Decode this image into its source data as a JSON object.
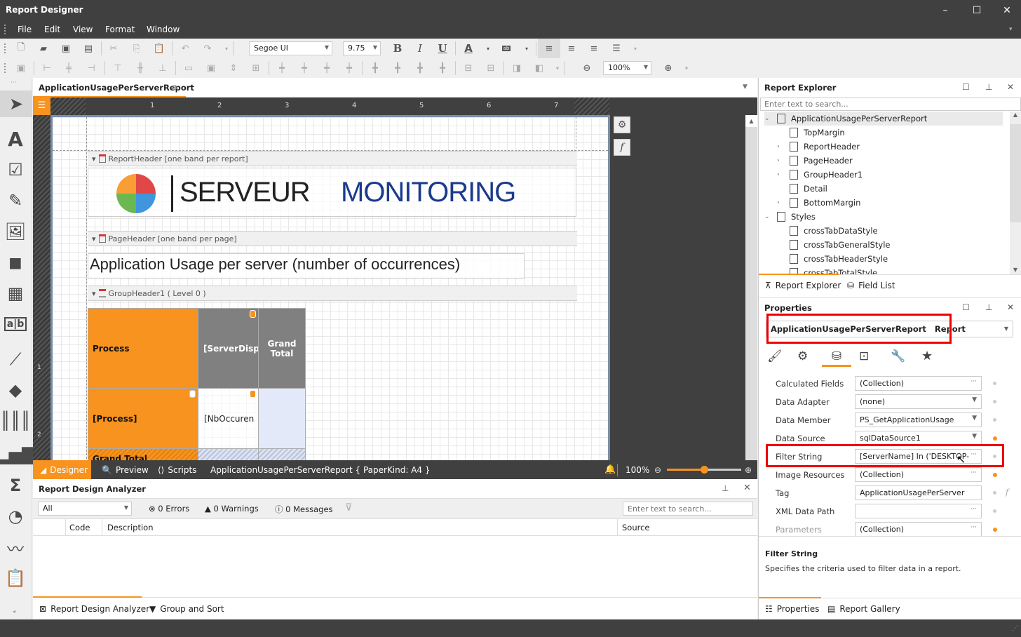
{
  "window": {
    "title": "Report Designer",
    "minimize": "–",
    "maximize": "☐",
    "close": "✕"
  },
  "menu": [
    "File",
    "Edit",
    "View",
    "Format",
    "Window"
  ],
  "toolbar": {
    "font_name": "Segoe UI",
    "font_size": "9.75",
    "bold": "B",
    "italic": "I",
    "underline": "U",
    "font_color": "A",
    "zoom": "100%"
  },
  "document_tab": {
    "label": "ApplicationUsagePerServerReport"
  },
  "ruler": {
    "marks": [
      "1",
      "2",
      "3",
      "4",
      "5",
      "6",
      "7"
    ],
    "vertical_marks": [
      "1",
      "2"
    ]
  },
  "report": {
    "bands": {
      "report_header": "ReportHeader [one band per report]",
      "page_header": "PageHeader [one band per page]",
      "group_header": "GroupHeader1 ( Level 0 )"
    },
    "logo": {
      "part1": "SERVEUR",
      "part2": "MONITORING"
    },
    "page_title": "Application Usage per server (number of occurrences)",
    "crosstab": {
      "process_header": "Process",
      "column_field": "[ServerDisp",
      "grand_total_col": "Grand Total",
      "row_field": "[Process]",
      "data_field": "[NbOccuren",
      "grand_total_row": "Grand Total"
    }
  },
  "bottom_tabs": {
    "designer": "Designer",
    "preview": "Preview",
    "scripts": "Scripts",
    "info": "ApplicationUsagePerServerReport { PaperKind: A4 }",
    "zoom": "100%",
    "zoom_fraction": 0.5
  },
  "analyzer": {
    "title": "Report Design Analyzer",
    "filter": "All",
    "errors": "0 Errors",
    "warnings": "0 Warnings",
    "messages": "0 Messages",
    "search_placeholder": "Enter text to search...",
    "columns": [
      "Code",
      "Description",
      "Source"
    ],
    "tabs": [
      "Report Design Analyzer",
      "Group and Sort"
    ]
  },
  "explorer": {
    "title": "Report Explorer",
    "search_placeholder": "Enter text to search...",
    "items": [
      {
        "label": "ApplicationUsagePerServerReport",
        "level": 0,
        "expander": "open"
      },
      {
        "label": "TopMargin",
        "level": 1,
        "expander": ""
      },
      {
        "label": "ReportHeader",
        "level": 1,
        "expander": "closed"
      },
      {
        "label": "PageHeader",
        "level": 1,
        "expander": "closed"
      },
      {
        "label": "GroupHeader1",
        "level": 1,
        "expander": "closed"
      },
      {
        "label": "Detail",
        "level": 1,
        "expander": ""
      },
      {
        "label": "BottomMargin",
        "level": 1,
        "expander": "closed"
      },
      {
        "label": "Styles",
        "level": 0,
        "expander": "open"
      },
      {
        "label": "crossTabDataStyle",
        "level": 1,
        "expander": ""
      },
      {
        "label": "crossTabGeneralStyle",
        "level": 1,
        "expander": ""
      },
      {
        "label": "crossTabHeaderStyle",
        "level": 1,
        "expander": ""
      },
      {
        "label": "crossTabTotalStyle",
        "level": 1,
        "expander": ""
      }
    ],
    "tabs": [
      "Report Explorer",
      "Field List"
    ]
  },
  "properties": {
    "title": "Properties",
    "selected_object": "ApplicationUsagePerServerReport",
    "selected_type": "Report",
    "rows": [
      {
        "label": "Calculated Fields",
        "value": "(Collection)",
        "editor": "ellipsis",
        "modified": false
      },
      {
        "label": "Data Adapter",
        "value": "(none)",
        "editor": "dropdown",
        "modified": false
      },
      {
        "label": "Data Member",
        "value": "PS_GetApplicationUsage",
        "editor": "dropdown",
        "modified": false
      },
      {
        "label": "Data Source",
        "value": "sqlDataSource1",
        "editor": "dropdown",
        "modified": true
      },
      {
        "label": "Filter String",
        "value": "[ServerName] In ('DESKTOP-",
        "editor": "ellipsis",
        "modified": false
      },
      {
        "label": "Image Resources",
        "value": "(Collection)",
        "editor": "ellipsis",
        "modified": true
      },
      {
        "label": "Tag",
        "value": "ApplicationUsagePerServer",
        "editor": "none",
        "modified": false
      },
      {
        "label": "XML Data Path",
        "value": "",
        "editor": "ellipsis",
        "modified": false
      },
      {
        "label": "Parameters",
        "value": "(Collection)",
        "editor": "ellipsis",
        "modified": true
      }
    ],
    "description_title": "Filter String",
    "description_text": "Specifies the criteria used to filter data in a report.",
    "tabs": [
      "Properties",
      "Report Gallery"
    ]
  }
}
